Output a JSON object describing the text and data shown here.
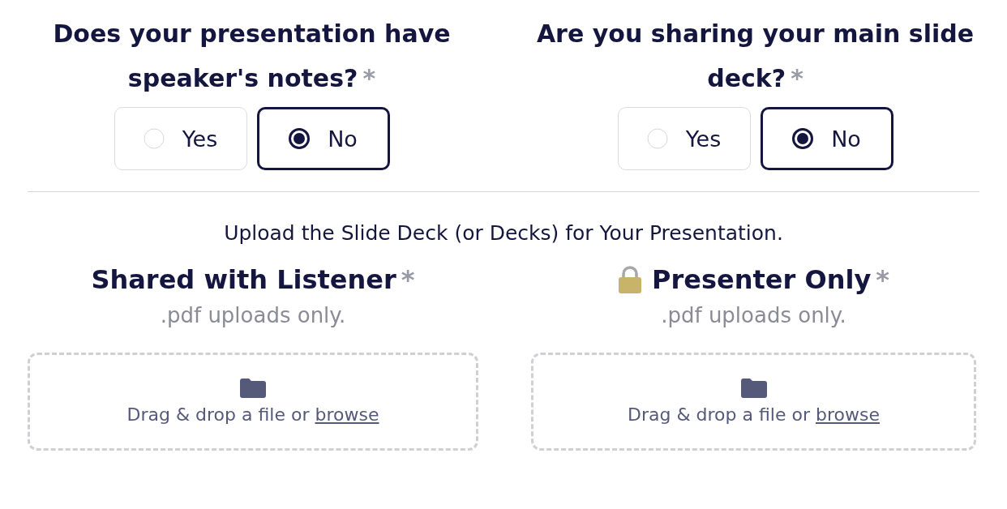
{
  "questions": [
    {
      "title": "Does your presentation have speaker's notes?",
      "required": "*",
      "options": [
        {
          "label": "Yes",
          "selected": false
        },
        {
          "label": "No",
          "selected": true
        }
      ]
    },
    {
      "title": "Are you sharing your main slide deck?",
      "required": "*",
      "options": [
        {
          "label": "Yes",
          "selected": false
        },
        {
          "label": "No",
          "selected": true
        }
      ]
    }
  ],
  "upload": {
    "title": "Upload the Slide Deck (or Decks) for Your Presentation.",
    "sections": [
      {
        "kind": "plain",
        "title": "Shared with Listener",
        "required": "*",
        "hint": ".pdf uploads only.",
        "dropzone": {
          "text": "Drag & drop a file or",
          "link": "browse"
        }
      },
      {
        "kind": "locked",
        "title": "Presenter Only",
        "required": "*",
        "hint": ".pdf uploads only.",
        "dropzone": {
          "text": "Drag & drop a file or",
          "link": "browse"
        }
      }
    ]
  }
}
